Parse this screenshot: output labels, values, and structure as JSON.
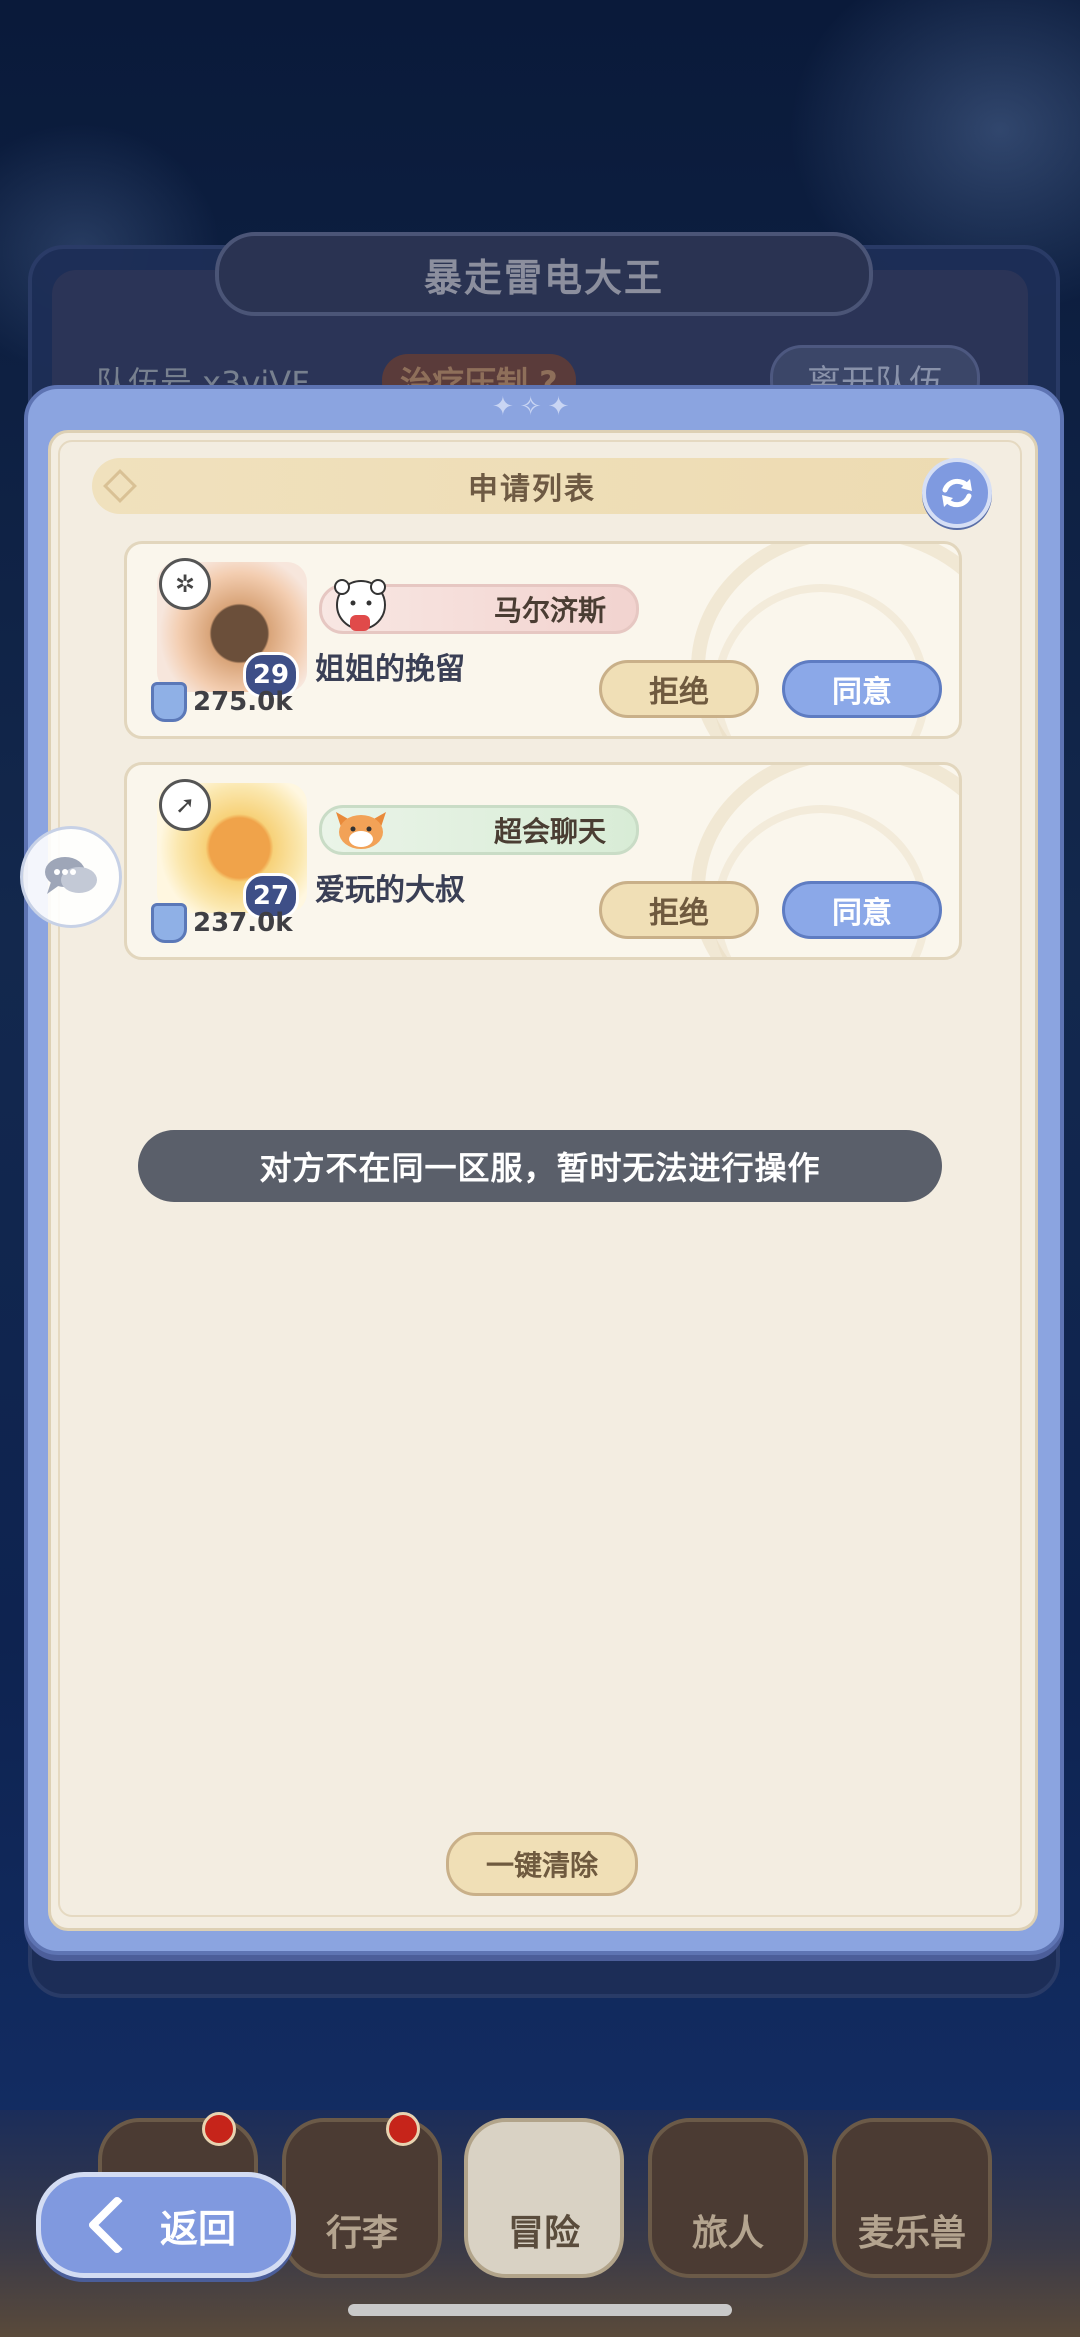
{
  "team": {
    "title": "暴走雷电大王",
    "team_id": "队伍号 x3vjVF",
    "heal_tag": "治疗压制 ?",
    "leave_label": "离开队伍"
  },
  "modal": {
    "title": "申请列表",
    "clear_label": "一键清除"
  },
  "applicants": [
    {
      "title_tag": "马尔济斯",
      "name": "姐姐的挽留",
      "level": "29",
      "power": "275.0k",
      "reject_label": "拒绝",
      "accept_label": "同意"
    },
    {
      "title_tag": "超会聊天",
      "name": "爱玩的大叔",
      "level": "27",
      "power": "237.0k",
      "reject_label": "拒绝",
      "accept_label": "同意"
    }
  ],
  "toast": "对方不在同一区服，暂时无法进行操作",
  "nav": {
    "back_label": "返回",
    "items": [
      {
        "label": "行李"
      },
      {
        "label": "冒险"
      },
      {
        "label": "旅人"
      },
      {
        "label": "麦乐兽"
      }
    ]
  },
  "colors": {
    "accent_blue": "#8ba8e8",
    "parchment": "#f3ede1",
    "reject_tan": "#f0dfb6",
    "badge_red": "#c6241a"
  },
  "icons": [
    "refresh-icon",
    "chat-bubbles-icon",
    "shield-icon",
    "back-arrow-icon"
  ]
}
